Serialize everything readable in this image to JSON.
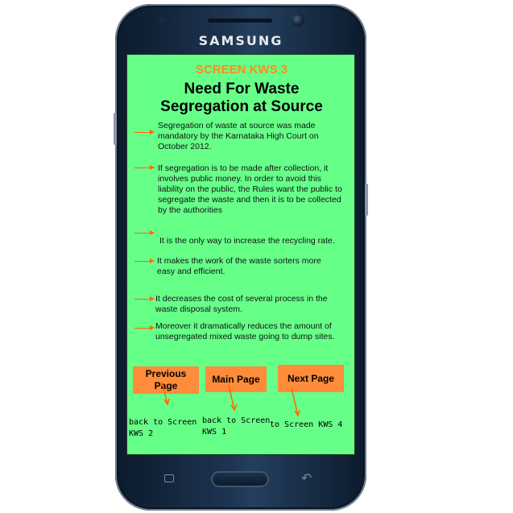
{
  "device": {
    "brand": "SAMSUNG"
  },
  "screen": {
    "label": "SCREEN KWS 3",
    "title_line1": "Need For Waste",
    "title_line2": "Segregation at Source",
    "bullets": [
      "Segregation of waste at source was made mandatory by the Karnataka High Court on October 2012.",
      "If segregation is to be made after collection, it involves public money. In order to avoid this liability on the public, the Rules want the public to segregate the waste and then it is to be collected by the authorities",
      "It is the only way to increase the recycling rate.",
      "It makes the work of the waste sorters more easy and efficient.",
      "It decreases the cost of several process in the waste disposal system.",
      "Moreover it dramatically reduces the amount of unsegregated mixed waste going to dump sites."
    ],
    "buttons": {
      "previous_line1": "Previous",
      "previous_line2": "Page",
      "main": "Main Page",
      "next": "Next Page"
    },
    "annotations": {
      "previous_line1": "back to Screen",
      "previous_line2": "KWS 2",
      "main_line1": "back to Screen",
      "main_line2": "KWS 1",
      "next": "to Screen KWS 4"
    },
    "colors": {
      "background": "#66ff88",
      "accent": "#ff8c1a",
      "button": "#ff8c3a",
      "arrow": "#ff6600"
    }
  }
}
